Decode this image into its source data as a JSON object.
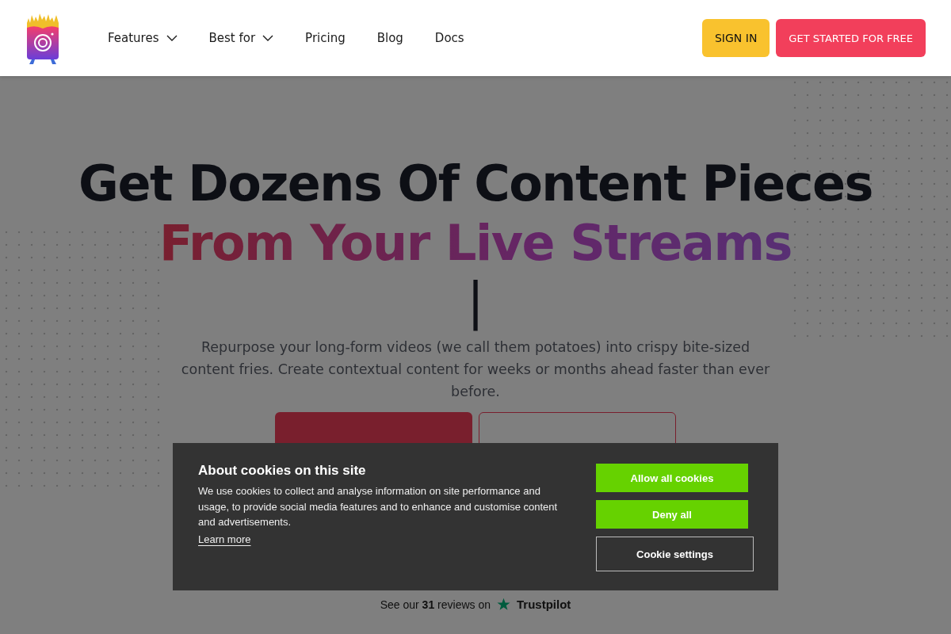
{
  "nav": {
    "items": [
      {
        "label": "Features",
        "dropdown": true
      },
      {
        "label": "Best for",
        "dropdown": true
      },
      {
        "label": "Pricing",
        "dropdown": false
      },
      {
        "label": "Blog",
        "dropdown": false
      },
      {
        "label": "Docs",
        "dropdown": false
      }
    ],
    "sign_in": "SIGN IN",
    "get_started": "GET STARTED FOR FREE"
  },
  "hero": {
    "title": "Get Dozens Of Content Pieces",
    "subtitle": "From Your Live Streams",
    "cursor": "|",
    "description": "Repurpose your long-form videos (we call them potatoes) into crispy bite-sized content fries. Create contextual content for weeks or months ahead faster than ever before.",
    "reviews": {
      "prefix": "See our",
      "count": "31",
      "suffix": "reviews on",
      "brand": "Trustpilot"
    }
  },
  "cookie_banner": {
    "title": "About cookies on this site",
    "text": "We use cookies to collect and analyse information on site performance and usage, to provide social media features and to enhance and customise content and advertisements.",
    "link": "Learn more",
    "buttons": [
      {
        "label": "Allow all cookies",
        "kind": "primary"
      },
      {
        "label": "Deny all",
        "kind": "primary"
      },
      {
        "label": "Cookie settings",
        "kind": "outline"
      }
    ]
  }
}
